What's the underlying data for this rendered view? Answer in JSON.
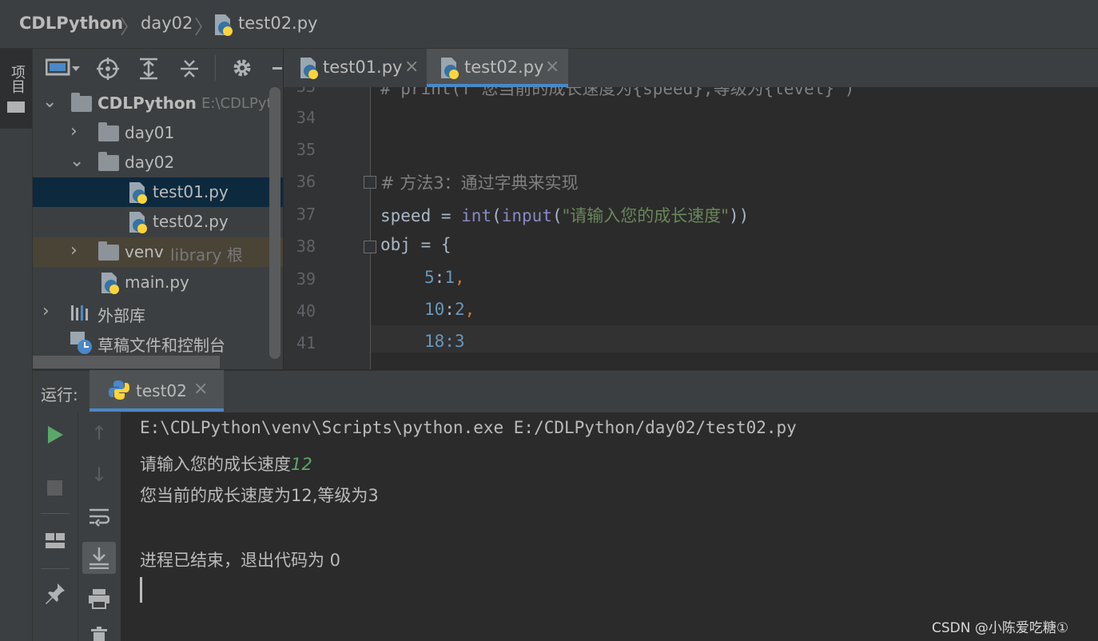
{
  "breadcrumb": {
    "project": "CDLPython",
    "folder": "day02",
    "file": "test02.py"
  },
  "left_stripe": {
    "project_tab": "项目"
  },
  "project_tree": {
    "root": {
      "name": "CDLPython",
      "path": "E:\\CDLPyth"
    },
    "items": [
      {
        "name": "day01"
      },
      {
        "name": "day02"
      },
      {
        "name": "test01.py"
      },
      {
        "name": "test02.py"
      },
      {
        "name": "venv",
        "hint": "library 根"
      },
      {
        "name": "main.py"
      },
      {
        "name": "外部库"
      },
      {
        "name": "草稿文件和控制台"
      }
    ]
  },
  "editor": {
    "tabs": [
      {
        "label": "test01.py"
      },
      {
        "label": "test02.py"
      }
    ],
    "partial_line": "# print(f\"您当前的成长速度为{speed},等级为{level}\")",
    "lines": [
      {
        "num": "34"
      },
      {
        "num": "35"
      },
      {
        "num": "36",
        "comment": "# 方法3：通过字典来实现"
      },
      {
        "num": "37",
        "var": "speed = ",
        "fn1": "int",
        "p1": "(",
        "fn2": "input",
        "p2": "(",
        "str": "\"请输入您的成长速度\"",
        "p3": "))"
      },
      {
        "num": "38",
        "text": "obj = {"
      },
      {
        "num": "39",
        "key": "5",
        "colon": ":",
        "val": "1",
        "comma": ","
      },
      {
        "num": "40",
        "key": "10",
        "colon": ":",
        "val": "2",
        "comma": ","
      },
      {
        "num": "41",
        "partial": "18:3"
      }
    ]
  },
  "run_panel": {
    "label": "运行:",
    "tab": "test02",
    "console": {
      "command": "E:\\CDLPython\\venv\\Scripts\\python.exe E:/CDLPython/day02/test02.py",
      "prompt": "请输入您的成长速度",
      "user_input": "12",
      "output": "您当前的成长速度为12,等级为3",
      "exit": "进程已结束，退出代码为 0"
    }
  },
  "watermark": "CSDN @小陈爱吃糖①",
  "colors": {
    "accent": "#4a88c7",
    "run_green": "#59a869",
    "selection": "#0d293e",
    "library_row": "#4a4437"
  }
}
